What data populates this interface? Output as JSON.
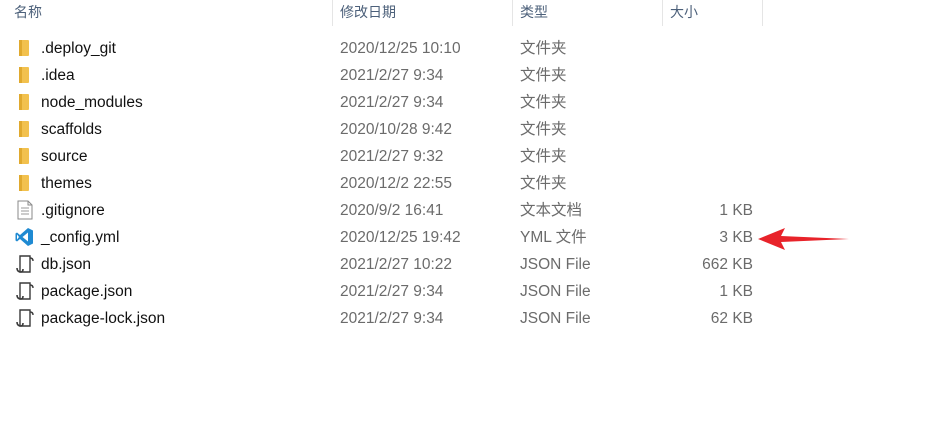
{
  "header": {
    "name": "名称",
    "date_modified": "修改日期",
    "type": "类型",
    "size": "大小"
  },
  "files": [
    {
      "name": ".deploy_git",
      "date": "2020/12/25 10:10",
      "type": "文件夹",
      "size": "",
      "icon": "folder-icon"
    },
    {
      "name": ".idea",
      "date": "2021/2/27 9:34",
      "type": "文件夹",
      "size": "",
      "icon": "folder-icon"
    },
    {
      "name": "node_modules",
      "date": "2021/2/27 9:34",
      "type": "文件夹",
      "size": "",
      "icon": "folder-icon"
    },
    {
      "name": "scaffolds",
      "date": "2020/10/28 9:42",
      "type": "文件夹",
      "size": "",
      "icon": "folder-icon"
    },
    {
      "name": "source",
      "date": "2021/2/27 9:32",
      "type": "文件夹",
      "size": "",
      "icon": "folder-icon"
    },
    {
      "name": "themes",
      "date": "2020/12/2 22:55",
      "type": "文件夹",
      "size": "",
      "icon": "folder-icon"
    },
    {
      "name": ".gitignore",
      "date": "2020/9/2 16:41",
      "type": "文本文档",
      "size": "1 KB",
      "icon": "text-document-icon"
    },
    {
      "name": "_config.yml",
      "date": "2020/12/25 19:42",
      "type": "YML 文件",
      "size": "3 KB",
      "icon": "vscode-icon"
    },
    {
      "name": "db.json",
      "date": "2021/2/27 10:22",
      "type": "JSON File",
      "size": "662 KB",
      "icon": "json-file-icon"
    },
    {
      "name": "package.json",
      "date": "2021/2/27 9:34",
      "type": "JSON File",
      "size": "1 KB",
      "icon": "json-file-icon"
    },
    {
      "name": "package-lock.json",
      "date": "2021/2/27 9:34",
      "type": "JSON File",
      "size": "62 KB",
      "icon": "json-file-icon"
    }
  ],
  "colors": {
    "folder": "#f2c14e",
    "vscode_blue": "#1f8ad2",
    "arrow_red": "#e8232a",
    "header_text": "#4c607a"
  }
}
